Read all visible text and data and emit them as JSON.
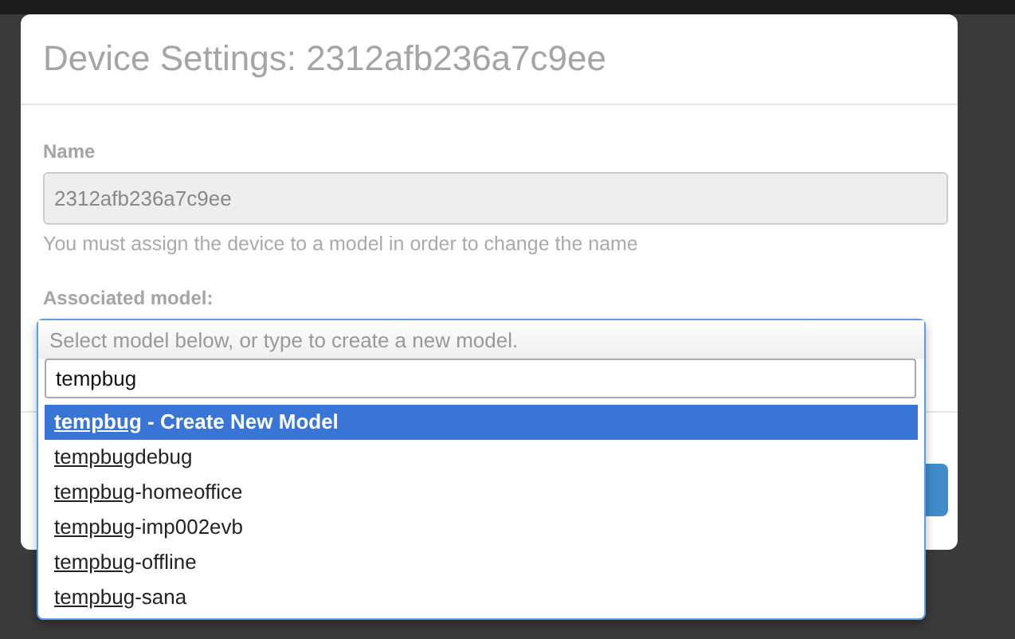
{
  "dialog": {
    "title": "Device Settings: 2312afb236a7c9ee",
    "name_field": {
      "label": "Name",
      "value": "2312afb236a7c9ee",
      "disabled": true,
      "help": "You must assign the device to a model in order to change the name"
    },
    "model_field": {
      "label": "Associated model:",
      "hint": "Select model below, or type to create a new model.",
      "search": "tempbug",
      "options": [
        {
          "match": "tempbug",
          "rest": " - Create New Model",
          "selected": true
        },
        {
          "match": "tempbug",
          "rest": "debug",
          "selected": false
        },
        {
          "match": "tempbug",
          "rest": "-homeoffice",
          "selected": false
        },
        {
          "match": "tempbug",
          "rest": "-imp002evb",
          "selected": false
        },
        {
          "match": "tempbug",
          "rest": "-offline",
          "selected": false
        },
        {
          "match": "tempbug",
          "rest": "-sana",
          "selected": false
        }
      ]
    }
  }
}
